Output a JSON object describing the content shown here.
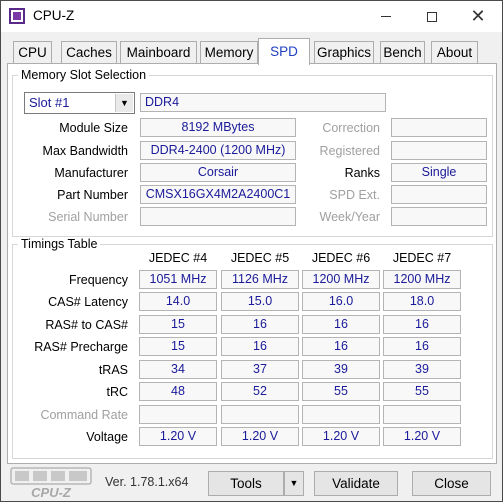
{
  "window": {
    "title": "CPU-Z"
  },
  "tabs": [
    {
      "label": "CPU"
    },
    {
      "label": "Caches"
    },
    {
      "label": "Mainboard"
    },
    {
      "label": "Memory"
    },
    {
      "label": "SPD"
    },
    {
      "label": "Graphics"
    },
    {
      "label": "Bench"
    },
    {
      "label": "About"
    }
  ],
  "memory_slot": {
    "group_title": "Memory Slot Selection",
    "slot_selected": "Slot #1",
    "type": "DDR4",
    "module_size_label": "Module Size",
    "module_size": "8192 MBytes",
    "max_bandwidth_label": "Max Bandwidth",
    "max_bandwidth": "DDR4-2400 (1200 MHz)",
    "manufacturer_label": "Manufacturer",
    "manufacturer": "Corsair",
    "part_number_label": "Part Number",
    "part_number": "CMSX16GX4M2A2400C1",
    "serial_number_label": "Serial Number",
    "serial_number": "",
    "correction_label": "Correction",
    "correction": "",
    "registered_label": "Registered",
    "registered": "",
    "ranks_label": "Ranks",
    "ranks": "Single",
    "spd_ext_label": "SPD Ext.",
    "spd_ext": "",
    "week_year_label": "Week/Year",
    "week_year": ""
  },
  "timings": {
    "group_title": "Timings Table",
    "columns": [
      "JEDEC #4",
      "JEDEC #5",
      "JEDEC #6",
      "JEDEC #7"
    ],
    "rows": [
      {
        "label": "Frequency",
        "values": [
          "1051 MHz",
          "1126 MHz",
          "1200 MHz",
          "1200 MHz"
        ]
      },
      {
        "label": "CAS# Latency",
        "values": [
          "14.0",
          "15.0",
          "16.0",
          "18.0"
        ]
      },
      {
        "label": "RAS# to CAS#",
        "values": [
          "15",
          "16",
          "16",
          "16"
        ]
      },
      {
        "label": "RAS# Precharge",
        "values": [
          "15",
          "16",
          "16",
          "16"
        ]
      },
      {
        "label": "tRAS",
        "values": [
          "34",
          "37",
          "39",
          "39"
        ]
      },
      {
        "label": "tRC",
        "values": [
          "48",
          "52",
          "55",
          "55"
        ]
      },
      {
        "label": "Command Rate",
        "values": [
          "",
          "",
          "",
          ""
        ]
      },
      {
        "label": "Voltage",
        "values": [
          "1.20 V",
          "1.20 V",
          "1.20 V",
          "1.20 V"
        ]
      }
    ]
  },
  "footer": {
    "logo_text": "CPU-Z",
    "version": "Ver. 1.78.1.x64",
    "tools_label": "Tools",
    "validate_label": "Validate",
    "close_label": "Close"
  },
  "colors": {
    "value_text": "#1a1a9a",
    "active_tab_text": "#2040c0",
    "dim_label": "#a0a0a0"
  }
}
